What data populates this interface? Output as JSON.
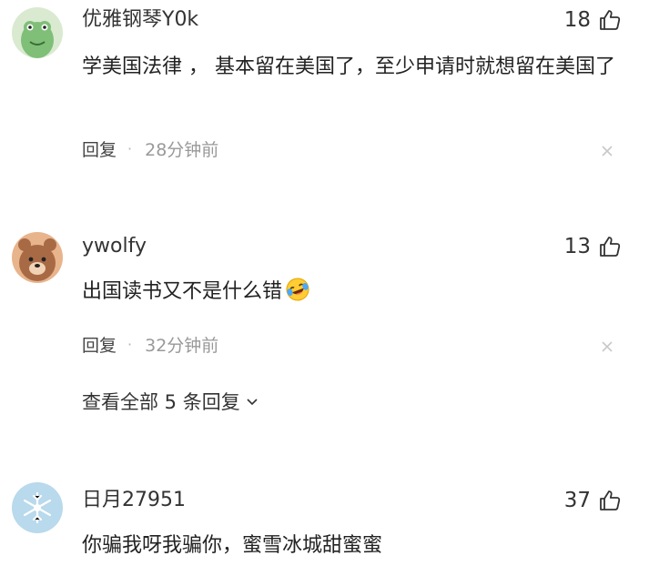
{
  "comments": [
    {
      "username": "优雅钢琴Y0k",
      "likes": "18",
      "text": "学美国法律 ， 基本留在美国了，至少申请时就想留在美国了",
      "reply_label": "回复",
      "separator": "·",
      "time": "28分钟前",
      "avatar_icon": "green-frog-avatar",
      "avatar_color": "#8ec98a"
    },
    {
      "username": "ywolfy",
      "likes": "13",
      "text": "出国读书又不是什么错",
      "emoji": "laughing-crying-emoji",
      "reply_label": "回复",
      "separator": "·",
      "time": "32分钟前",
      "expand_label": "查看全部 5 条回复",
      "avatar_icon": "brown-bear-avatar",
      "avatar_color": "#a86a45"
    },
    {
      "username": "日月27951",
      "likes": "37",
      "text": "你骗我呀我骗你，蜜雪冰城甜蜜蜜",
      "avatar_icon": "snowflake-avatar",
      "avatar_color": "#b9d9ec"
    }
  ],
  "icons": {
    "like": "thumbs-up-icon",
    "close": "close-icon",
    "expand": "chevron-down-icon"
  },
  "colors": {
    "text_primary": "#222222",
    "text_secondary": "#999999"
  }
}
